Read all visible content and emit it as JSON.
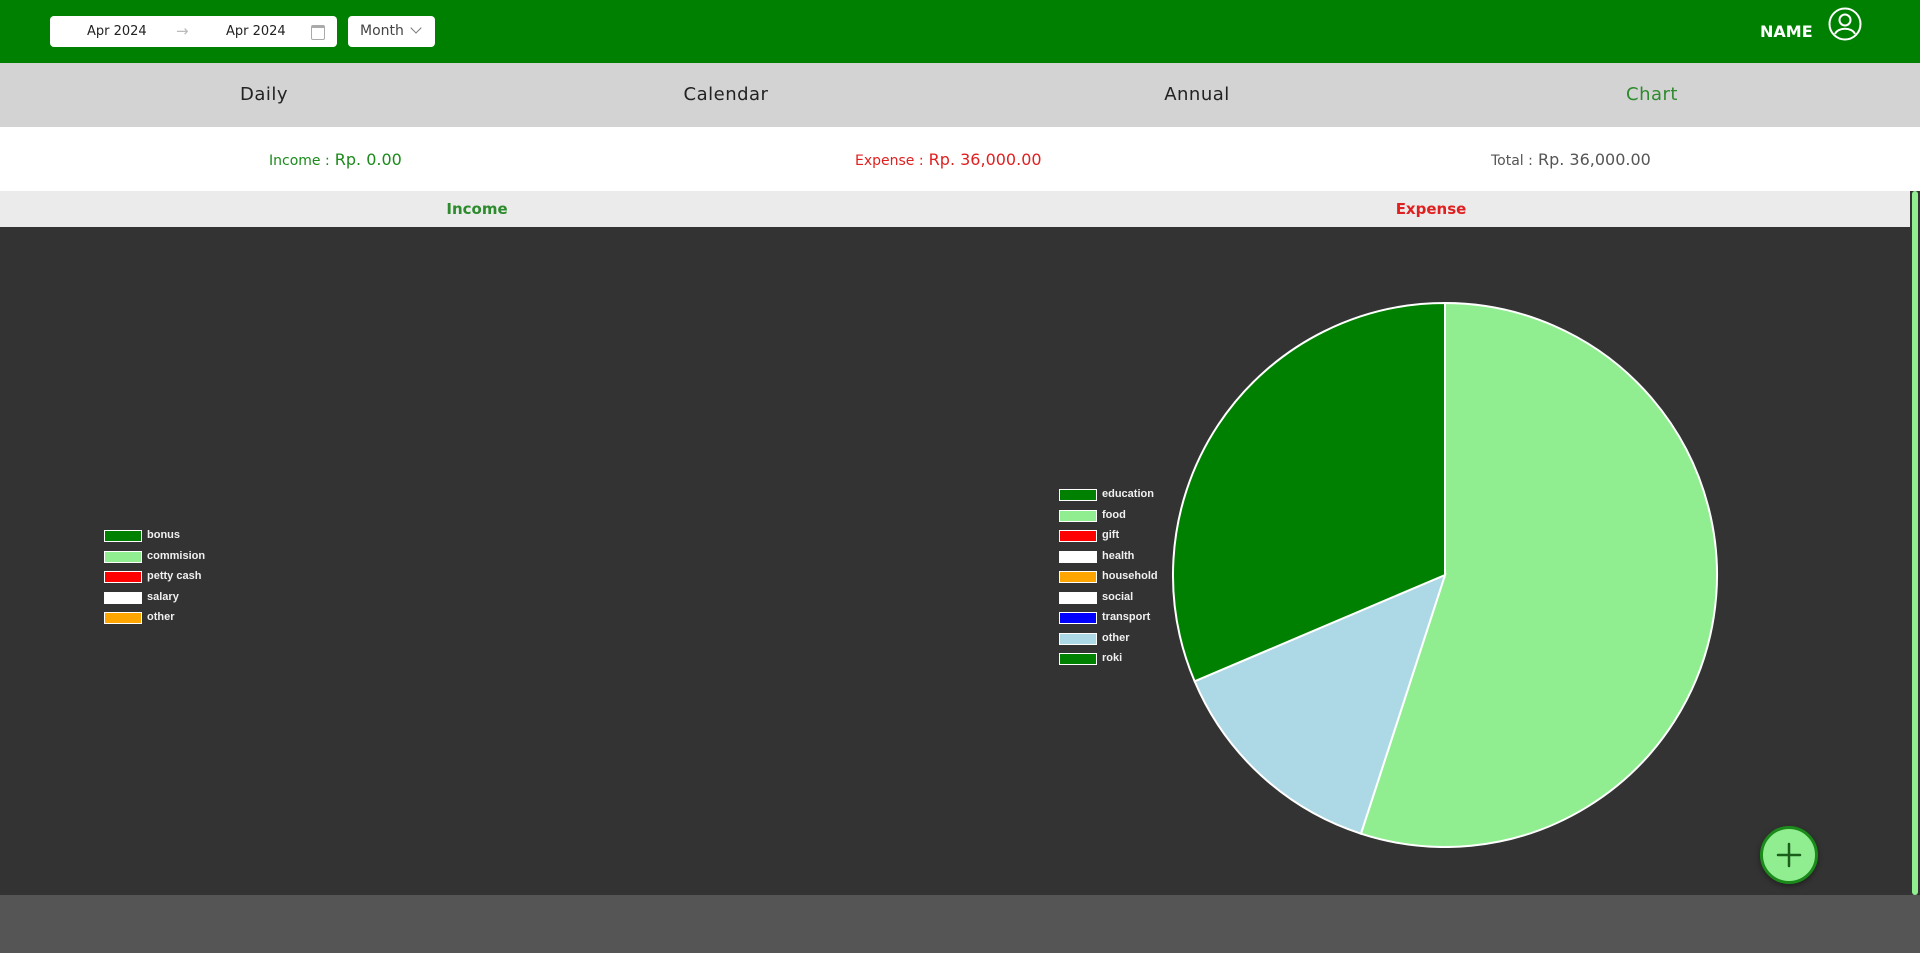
{
  "header": {
    "range_start": "Apr 2024",
    "range_end": "Apr 2024",
    "range_separator": "→",
    "period_mode": "Month",
    "user_name": "NAME"
  },
  "tabs": [
    {
      "label": "Daily",
      "active": false
    },
    {
      "label": "Calendar",
      "active": false
    },
    {
      "label": "Annual",
      "active": false
    },
    {
      "label": "Chart",
      "active": true
    }
  ],
  "summary": {
    "income_label": "Income :",
    "income_value": "Rp. 0.00",
    "expense_label": "Expense :",
    "expense_value": "Rp. 36,000.00",
    "total_label": "Total :",
    "total_value": "Rp. 36,000.00"
  },
  "sections": {
    "income_title": "Income",
    "expense_title": "Expense"
  },
  "colors": {
    "brand": "#008000",
    "income": "#2d8a2d",
    "expense": "#e02020"
  },
  "chart_data": [
    {
      "type": "pie",
      "title": "Income",
      "legend_position": "left",
      "categories": [
        "bonus",
        "commision",
        "petty cash",
        "salary",
        "other"
      ],
      "colors": [
        "#008000",
        "#90ee90",
        "#ff0000",
        "#ffffff",
        "#ffa500"
      ],
      "values": [
        0,
        0,
        0,
        0,
        0
      ]
    },
    {
      "type": "pie",
      "title": "Expense",
      "legend_position": "left",
      "categories": [
        "education",
        "food",
        "gift",
        "health",
        "household",
        "social",
        "transport",
        "other",
        "roki"
      ],
      "colors": [
        "#008000",
        "#90ee90",
        "#ff0000",
        "#ffffff",
        "#ffa500",
        "#ffffff",
        "#0000ff",
        "#add8e6",
        "#008000"
      ],
      "values": [
        11300,
        19800,
        0,
        0,
        0,
        0,
        0,
        4900,
        0
      ]
    }
  ]
}
